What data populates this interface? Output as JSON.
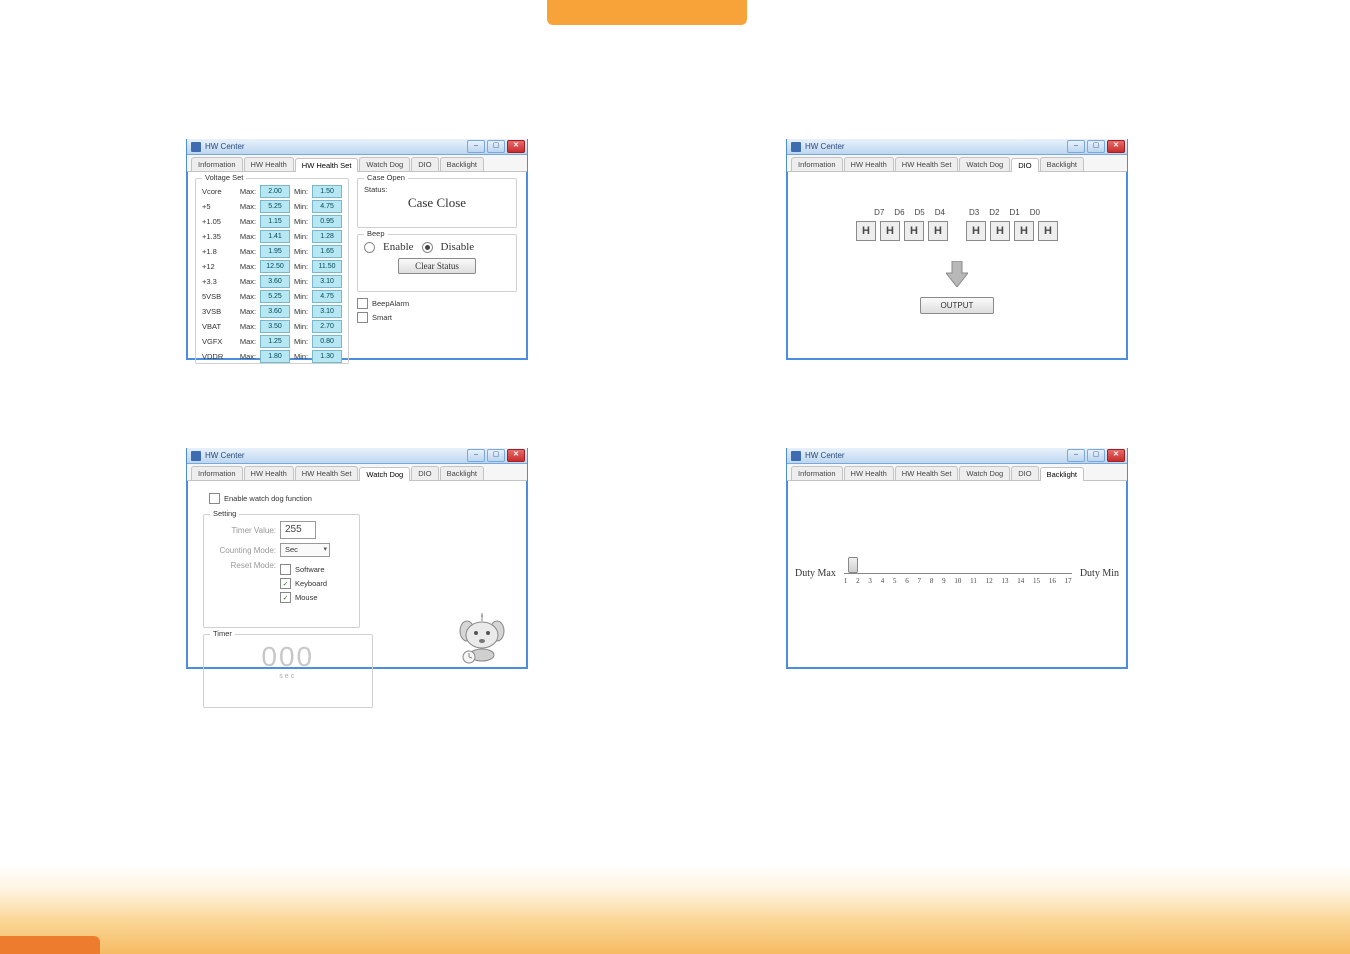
{
  "app_title": "HW Center",
  "tabs": [
    "Information",
    "HW Health",
    "HW Health Set",
    "Watch Dog",
    "DIO",
    "Backlight"
  ],
  "hw_health_set": {
    "group_voltage": "Voltage Set",
    "rows": [
      {
        "name": "Vcore",
        "max": "2.00",
        "min": "1.50"
      },
      {
        "name": "+5",
        "max": "5.25",
        "min": "4.75"
      },
      {
        "name": "+1.05",
        "max": "1.15",
        "min": "0.95"
      },
      {
        "name": "+1.35",
        "max": "1.41",
        "min": "1.28"
      },
      {
        "name": "+1.8",
        "max": "1.95",
        "min": "1.65"
      },
      {
        "name": "+12",
        "max": "12.50",
        "min": "11.50"
      },
      {
        "name": "+3.3",
        "max": "3.60",
        "min": "3.10"
      },
      {
        "name": "5VSB",
        "max": "5.25",
        "min": "4.75"
      },
      {
        "name": "3VSB",
        "max": "3.60",
        "min": "3.10"
      },
      {
        "name": "VBAT",
        "max": "3.50",
        "min": "2.70"
      },
      {
        "name": "VGFX",
        "max": "1.25",
        "min": "0.80"
      },
      {
        "name": "VDDR",
        "max": "1.80",
        "min": "1.30"
      }
    ],
    "lbl_max": "Max:",
    "lbl_min": "Min:",
    "group_caseopen": "Case Open",
    "status_label": "Status:",
    "status_value": "Case Close",
    "group_beep": "Beep",
    "beep_enable": "Enable",
    "beep_disable": "Disable",
    "clear_btn": "Clear Status",
    "chk_beepalarm": "BeepAlarm",
    "chk_smart": "Smart"
  },
  "watch_dog": {
    "enable_label": "Enable watch dog function",
    "group_setting": "Setting",
    "timer_value_lbl": "Timer Value:",
    "timer_value": "255",
    "counting_mode_lbl": "Counting Mode:",
    "counting_mode": "Sec",
    "reset_mode_lbl": "Reset Mode:",
    "reset_software": "Software",
    "reset_keyboard": "Keyboard",
    "reset_mouse": "Mouse",
    "group_timer": "Timer",
    "timer_digits": "000",
    "timer_unit": "sec"
  },
  "dio": {
    "labels": [
      "D7",
      "D6",
      "D5",
      "D4",
      "D3",
      "D2",
      "D1",
      "D0"
    ],
    "value": "H",
    "output_btn": "OUTPUT"
  },
  "backlight": {
    "duty_max": "Duty Max",
    "duty_min": "Duty Min",
    "ticks": [
      "1",
      "2",
      "3",
      "4",
      "5",
      "6",
      "7",
      "8",
      "9",
      "10",
      "11",
      "12",
      "13",
      "14",
      "15",
      "16",
      "17"
    ]
  }
}
